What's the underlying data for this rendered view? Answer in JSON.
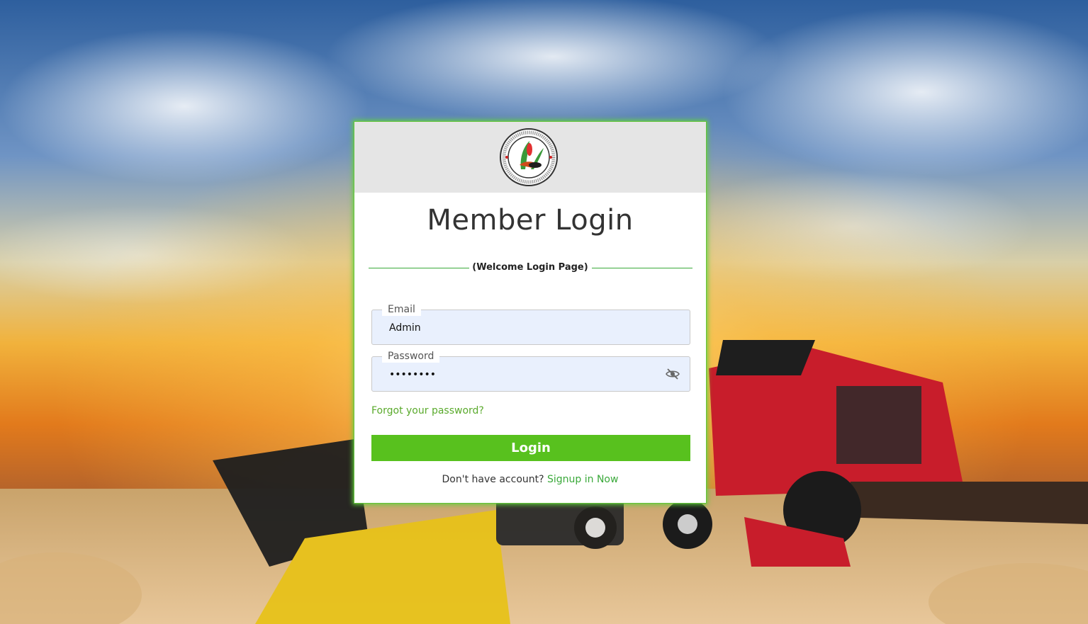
{
  "page": {
    "background_image": "harvester-field-sunset",
    "logo": {
      "icon": "association-seal-logo"
    }
  },
  "login": {
    "title": "Member Login",
    "subtitle": "(Welcome Login Page)",
    "email": {
      "label": "Email",
      "value": "Admin"
    },
    "password": {
      "label": "Password",
      "value": "••••••••",
      "toggle_icon": "eye-slash-icon"
    },
    "forgot_label": "Forgot your password?",
    "login_button": "Login",
    "signup_prompt": "Don't have account?",
    "signup_link": "Signup in Now"
  },
  "colors": {
    "accent": "#58c11e",
    "link": "#5aaa2c",
    "field_bg": "#e9f0fd",
    "header_bg": "#e5e5e5"
  }
}
